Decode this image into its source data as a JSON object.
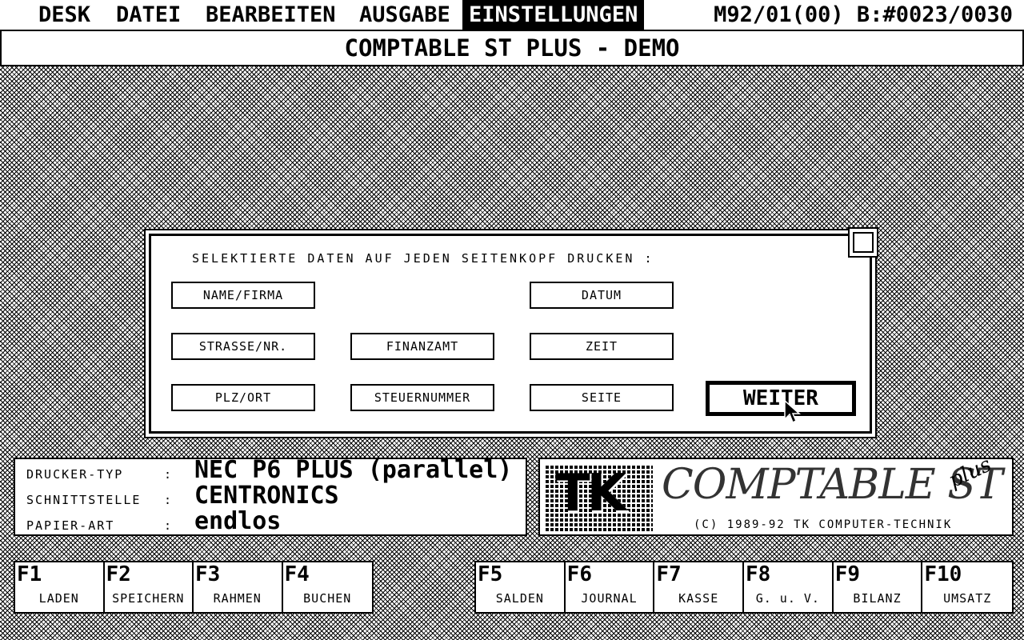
{
  "menubar": {
    "items": [
      {
        "label": "DESK",
        "active": false
      },
      {
        "label": "DATEI",
        "active": false
      },
      {
        "label": "BEARBEITEN",
        "active": false
      },
      {
        "label": "AUSGABE",
        "active": false
      },
      {
        "label": "EINSTELLUNGEN",
        "active": true
      }
    ],
    "status": "M92/01(00) B:#0023/0030"
  },
  "title": "COMPTABLE ST PLUS - DEMO",
  "dialog": {
    "prompt": "SELEKTIERTE DATEN AUF JEDEN SEITENKOPF DRUCKEN :",
    "options": [
      {
        "label": "NAME/FIRMA"
      },
      {
        "label": "DATUM"
      },
      {
        "label": "STRASSE/NR."
      },
      {
        "label": "FINANZAMT"
      },
      {
        "label": "ZEIT"
      },
      {
        "label": "PLZ/ORT"
      },
      {
        "label": "STEUERNUMMER"
      },
      {
        "label": "SEITE"
      }
    ],
    "continue_label": "WEITER"
  },
  "printer_info": {
    "rows": [
      {
        "label": "DRUCKER-TYP",
        "value": "NEC P6 PLUS (parallel)"
      },
      {
        "label": "SCHNITTSTELLE",
        "value": "CENTRONICS"
      },
      {
        "label": "PAPIER-ART",
        "value": "endlos"
      }
    ]
  },
  "logo": {
    "mark": "TK",
    "product": "COMPTABLE ST",
    "edition": "plus",
    "copyright": "(C) 1989-92 TK COMPUTER-TECHNIK"
  },
  "function_keys_left": [
    {
      "key": "F1",
      "label": "LADEN"
    },
    {
      "key": "F2",
      "label": "SPEICHERN"
    },
    {
      "key": "F3",
      "label": "RAHMEN"
    },
    {
      "key": "F4",
      "label": "BUCHEN"
    }
  ],
  "function_keys_right": [
    {
      "key": "F5",
      "label": "SALDEN"
    },
    {
      "key": "F6",
      "label": "JOURNAL"
    },
    {
      "key": "F7",
      "label": "KASSE"
    },
    {
      "key": "F8",
      "label": "G. u. V."
    },
    {
      "key": "F9",
      "label": "BILANZ"
    },
    {
      "key": "F10",
      "label": "UMSATZ"
    }
  ]
}
